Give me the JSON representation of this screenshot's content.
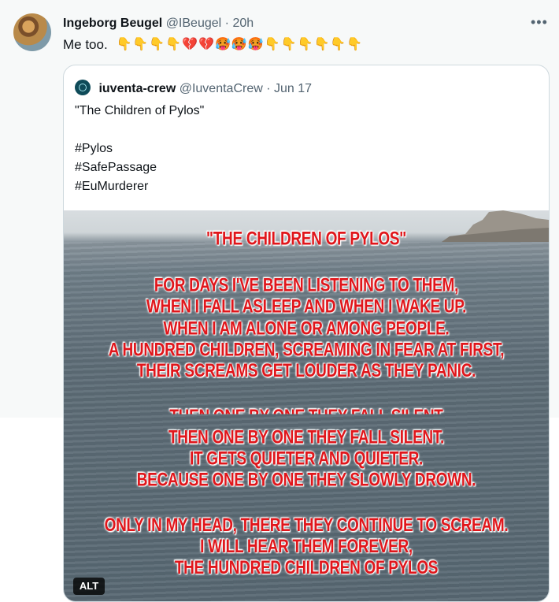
{
  "tweet": {
    "author_name": "Ingeborg Beugel",
    "author_handle": "@IBeugel",
    "separator": "·",
    "time": "20h",
    "text": "Me too.",
    "emojis": "👇👇👇👇💔💔🥵🥵🥵👇👇👇👇👇👇",
    "more_icon": "more-horizontal-icon"
  },
  "quote": {
    "author_name": "iuventa-crew",
    "author_handle": "@IuventaCrew",
    "separator": "·",
    "date": "Jun 17",
    "text_lines": [
      "\"The Children of Pylos\"",
      "",
      "#Pylos",
      "#SafePassage",
      "#EuMurderer"
    ],
    "media": {
      "poem_lines": [
        "\"THE CHILDREN OF PYLOS\"",
        "FOR DAYS I'VE BEEN LISTENING TO THEM,",
        "WHEN I FALL ASLEEP AND WHEN I WAKE UP.",
        "WHEN I AM ALONE OR AMONG PEOPLE.",
        "A HUNDRED CHILDREN, SCREAMING IN FEAR AT FIRST,",
        "THEIR SCREAMS GET LOUDER AS THEY PANIC.",
        "THEN ONE BY ONE THEY FALL SILENT",
        "THEN ONE BY ONE THEY FALL SILENT.",
        "IT GETS QUIETER AND QUIETER.",
        "BECAUSE ONE BY ONE THEY SLOWLY DROWN.",
        "ONLY IN MY HEAD, THERE THEY CONTINUE TO SCREAM.",
        "I WILL HEAR THEM FOREVER,",
        "THE HUNDRED CHILDREN OF PYLOS"
      ],
      "alt_badge": "ALT"
    }
  },
  "colors": {
    "poem_red": "#e0161b",
    "secondary_text": "#536471",
    "card_border": "#cfd9de"
  }
}
